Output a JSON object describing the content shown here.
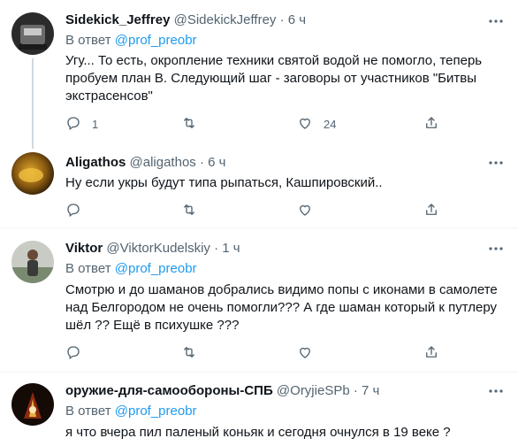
{
  "tweets": [
    {
      "name": "Sidekick_Jeffrey",
      "handle": "@SidekickJeffrey",
      "dot": "·",
      "time": "6 ч",
      "reply_prefix": "В ответ",
      "reply_mention": "@prof_preobr",
      "text": "Угу... То есть, окропление техники святой водой не помогло, теперь пробуем план B. Следующий шаг - заговоры от участников \"Битвы экстрасенсов\"",
      "replies": "1",
      "retweets": "",
      "likes": "24"
    },
    {
      "name": "Aligathos",
      "handle": "@aligathos",
      "dot": "·",
      "time": "6 ч",
      "text": "Ну если укры будут типа рыпаться, Кашпировский..",
      "replies": "",
      "retweets": "",
      "likes": ""
    },
    {
      "name": "Viktor",
      "handle": "@ViktorKudelskiy",
      "dot": "·",
      "time": "1 ч",
      "reply_prefix": "В ответ",
      "reply_mention": "@prof_preobr",
      "text": "Смотрю и до шаманов добрались видимо попы с иконами в самолете над Белгородом не очень помогли??? А где шаман который к путлеру шёл ?? Ещё в психушке ???",
      "replies": "",
      "retweets": "",
      "likes": ""
    },
    {
      "name": "оружие-для-самообороны-СПБ",
      "handle": "@OryjieSPb",
      "dot": "·",
      "time": "7 ч",
      "reply_prefix": "В ответ",
      "reply_mention": "@prof_preobr",
      "text": "я что вчера пил паленый коньяк и сегодня очнулся в 19 веке ?"
    }
  ],
  "colors": {
    "accent": "#1d9bf0",
    "secondary_text": "#536471",
    "divider": "#eff3f4"
  },
  "icons": [
    "more-icon",
    "reply-icon",
    "retweet-icon",
    "like-icon",
    "share-icon"
  ]
}
